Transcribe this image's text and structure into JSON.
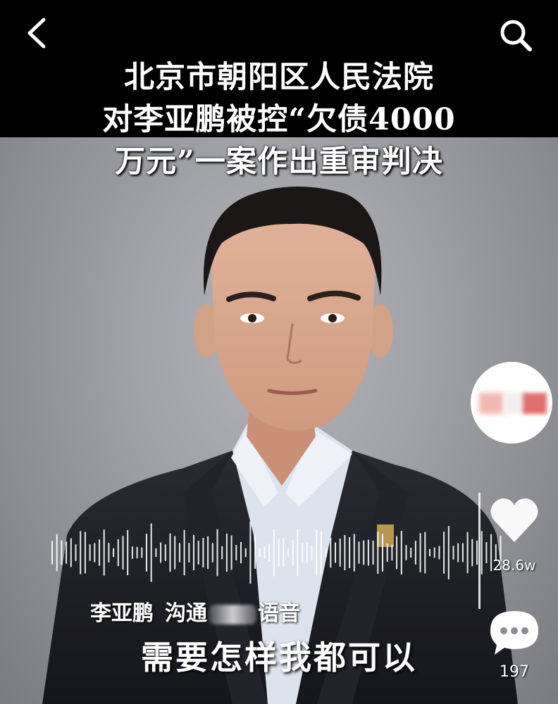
{
  "nav": {
    "back_icon": "chevron-left-icon",
    "search_icon": "search-icon"
  },
  "headline": {
    "line1": "北京市朝阳区人民法院",
    "line2": "对李亚鹏被控“欠债4000",
    "line3": "万元”一案作出重审判决"
  },
  "caption": {
    "speaker": "李亚鹏",
    "call_prefix": "沟通",
    "call_suffix": "语音",
    "quote": "需要怎样我都可以"
  },
  "actions": {
    "like_icon": "heart-icon",
    "like_count": "28.6w",
    "comment_icon": "comment-icon",
    "comment_count": "197"
  },
  "colors": {
    "background_gray": "#8c8d93",
    "suit": "#1c1d23",
    "shirt": "#dfe4ee",
    "text": "#ffffff"
  }
}
